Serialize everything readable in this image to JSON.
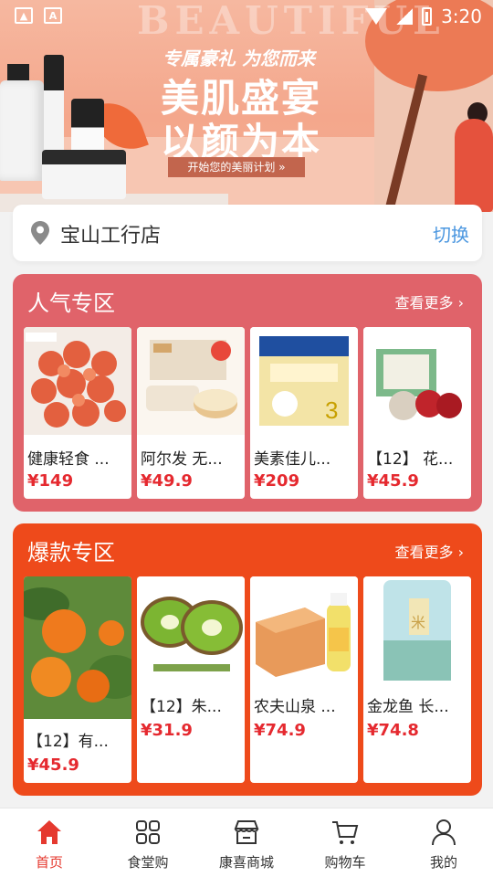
{
  "status_bar": {
    "time": "3:20",
    "left_icons": [
      "image-icon",
      "a-icon"
    ],
    "right_icons": [
      "wifi-icon",
      "signal-icon",
      "battery-icon"
    ]
  },
  "banner": {
    "bg_word": "BEAUTIFUL",
    "tagline": "专属豪礼 为您而来",
    "headline_1": "美肌盛宴",
    "headline_2": "以颜为本",
    "cta": "开始您的美丽计划 »"
  },
  "store": {
    "name": "宝山工行店",
    "switch_label": "切换",
    "icon": "location-pin-icon"
  },
  "popular": {
    "title": "人气专区",
    "more": "查看更多 ›",
    "color": "#e0636a",
    "items": [
      {
        "name": "健康轻食 ...",
        "price": "¥149"
      },
      {
        "name": "阿尔发 无...",
        "price": "¥49.9"
      },
      {
        "name": "美素佳儿...",
        "price": "¥209"
      },
      {
        "name": "【12】 花...",
        "price": "¥45.9"
      }
    ]
  },
  "hot": {
    "title": "爆款专区",
    "more": "查看更多 ›",
    "color": "#ee4a1b",
    "items": [
      {
        "name": "【12】有...",
        "price": "¥45.9"
      },
      {
        "name": "【12】朱...",
        "price": "¥31.9"
      },
      {
        "name": "农夫山泉 ...",
        "price": "¥74.9"
      },
      {
        "name": "金龙鱼 长...",
        "price": "¥74.8"
      }
    ]
  },
  "tabbar": {
    "active_color": "#e5392f",
    "tabs": [
      {
        "label": "首页",
        "icon": "home-icon",
        "active": true
      },
      {
        "label": "食堂购",
        "icon": "grid-icon",
        "active": false
      },
      {
        "label": "康喜商城",
        "icon": "store-icon",
        "active": false
      },
      {
        "label": "购物车",
        "icon": "cart-icon",
        "active": false
      },
      {
        "label": "我的",
        "icon": "user-icon",
        "active": false
      }
    ]
  }
}
